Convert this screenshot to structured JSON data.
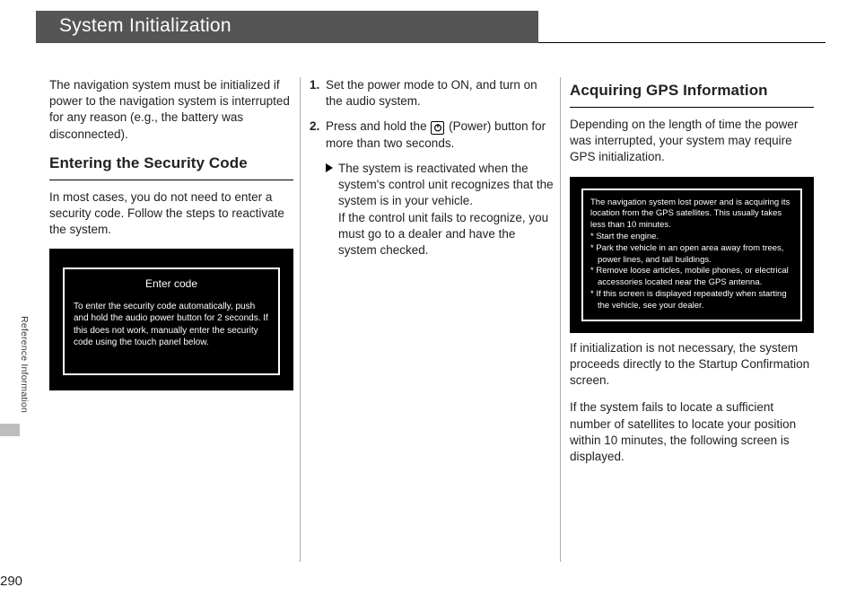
{
  "page_number": "290",
  "side_tab": "Reference Information",
  "title": "System Initialization",
  "col1": {
    "intro": "The navigation system must be initialized if power to the navigation system is interrupted for any reason (e.g., the battery was disconnected).",
    "h_security": "Entering the Security Code",
    "security_intro": "In most cases, you do not need to enter a security code. Follow the steps to reactivate the system.",
    "shot_title": "Enter code",
    "shot_body": "To enter the security code automatically, push and hold the audio power button for 2 seconds. If this does not work, manually enter the security code using the touch panel below."
  },
  "col2": {
    "step1": "Set the power mode to ON, and turn on the audio system.",
    "step2_a": "Press and hold the ",
    "step2_b": " (Power) button for more than two seconds.",
    "sub_a": "The system is reactivated when the system's control unit recognizes that the system is in your vehicle.",
    "sub_b": "If the control unit fails to recognize, you must go to a dealer and have the system checked."
  },
  "col3": {
    "h_gps": "Acquiring GPS Information",
    "gps_intro": "Depending on the length of time the power was interrupted, your system may require GPS initialization.",
    "shot_lines": [
      "The navigation system lost power and is acquiring its location from the GPS satellites. This usually takes less than 10 minutes.",
      "* Start the engine.",
      "* Park the vehicle in an open area away from trees, power lines, and tall buildings.",
      "* Remove loose articles, mobile phones, or electrical accessories located near the GPS antenna.",
      "* If this screen is displayed repeatedly when starting the vehicle, see your dealer."
    ],
    "after1": "If initialization is not necessary, the system proceeds directly to the Startup Confirmation screen.",
    "after2": "If the system fails to locate a sufficient number of satellites to locate your position within 10 minutes, the following screen is displayed."
  }
}
